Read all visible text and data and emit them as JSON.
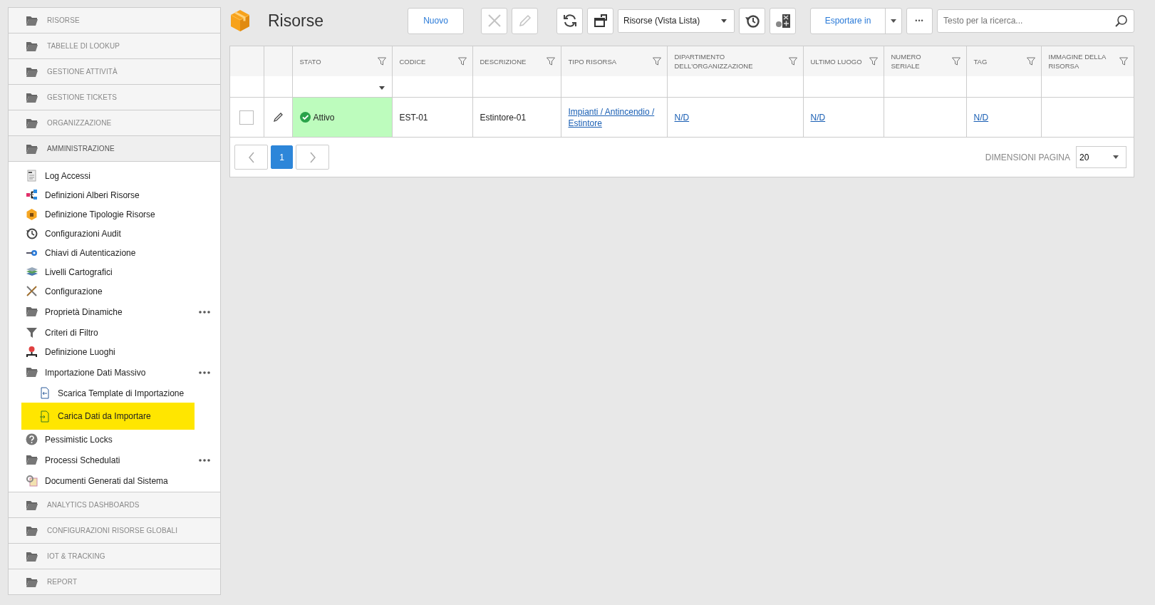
{
  "sidebar": {
    "sections": [
      {
        "label": "RISORSE",
        "expanded": false
      },
      {
        "label": "TABELLE DI LOOKUP",
        "expanded": false
      },
      {
        "label": "GESTIONE ATTIVITÀ",
        "expanded": false
      },
      {
        "label": "GESTIONE TICKETS",
        "expanded": false
      },
      {
        "label": "ORGANIZZAZIONE",
        "expanded": false
      },
      {
        "label": "AMMINISTRAZIONE",
        "expanded": true,
        "items": [
          {
            "label": "Log Accessi",
            "kind": "log",
            "has_menu": false,
            "highlighted": false
          },
          {
            "label": "Definizioni Alberi Risorse",
            "kind": "tree",
            "has_menu": false,
            "highlighted": false
          },
          {
            "label": "Definizione Tipologie Risorse",
            "kind": "types",
            "has_menu": false,
            "highlighted": false
          },
          {
            "label": "Configurazioni Audit",
            "kind": "audit",
            "has_menu": false,
            "highlighted": false
          },
          {
            "label": "Chiavi di Autenticazione",
            "kind": "key",
            "has_menu": false,
            "highlighted": false
          },
          {
            "label": "Livelli Cartografici",
            "kind": "layers",
            "has_menu": false,
            "highlighted": false
          },
          {
            "label": "Configurazione",
            "kind": "tools",
            "has_menu": false,
            "highlighted": false
          },
          {
            "label": "Proprietà Dinamiche",
            "kind": "folder",
            "has_menu": true,
            "highlighted": false
          },
          {
            "label": "Criteri di Filtro",
            "kind": "filter",
            "has_menu": false,
            "highlighted": false
          },
          {
            "label": "Definizione Luoghi",
            "kind": "places",
            "has_menu": false,
            "highlighted": false
          },
          {
            "label": "Importazione Dati Massivo",
            "kind": "folder",
            "has_menu": true,
            "highlighted": false,
            "children": [
              {
                "label": "Scarica Template di Importazione",
                "kind": "download",
                "has_menu": false,
                "highlighted": false
              },
              {
                "label": "Carica Dati da Importare",
                "kind": "upload",
                "has_menu": false,
                "highlighted": true
              }
            ]
          },
          {
            "label": "Pessimistic Locks",
            "kind": "help",
            "has_menu": false,
            "highlighted": false
          },
          {
            "label": "Processi Schedulati",
            "kind": "folder",
            "has_menu": true,
            "highlighted": false
          },
          {
            "label": "Documenti Generati dal Sistema",
            "kind": "docs",
            "has_menu": false,
            "highlighted": false
          }
        ]
      },
      {
        "label": "ANALYTICS DASHBOARDS",
        "expanded": false
      },
      {
        "label": "CONFIGURAZIONI RISORSE GLOBALI",
        "expanded": false
      },
      {
        "label": "IOT & TRACKING",
        "expanded": false
      },
      {
        "label": "REPORT",
        "expanded": false
      }
    ]
  },
  "header": {
    "title": "Risorse",
    "new_button": "Nuovo",
    "delete_disabled": true,
    "edit_disabled": true,
    "view_select": "Risorse (Vista Lista)",
    "export_button": "Esportare in",
    "more_button": "•••",
    "search": {
      "placeholder": "Testo per la ricerca..."
    }
  },
  "table": {
    "columns": [
      {
        "label": "STATO",
        "has_filter_select": true
      },
      {
        "label": "CODICE",
        "has_filter_select": false
      },
      {
        "label": "DESCRIZIONE",
        "has_filter_select": false
      },
      {
        "label": "TIPO RISORSA",
        "has_filter_select": false
      },
      {
        "label": "DIPARTIMENTO DELL'ORGANIZZAZIONE",
        "has_filter_select": false
      },
      {
        "label": "ULTIMO LUOGO",
        "has_filter_select": false
      },
      {
        "label": "NUMERO SERIALE",
        "has_filter_select": false
      },
      {
        "label": "TAG",
        "has_filter_select": false
      },
      {
        "label": "IMMAGINE DELLA RISORSA",
        "has_filter_select": false
      }
    ],
    "rows": [
      {
        "checked": false,
        "cells": [
          {
            "kind": "status",
            "text": "Attivo",
            "color": "#bdfcbd"
          },
          {
            "kind": "text",
            "text": "EST-01"
          },
          {
            "kind": "text",
            "text": "Estintore-01"
          },
          {
            "kind": "link",
            "text": "Impianti / Antincendio / Estintore"
          },
          {
            "kind": "link",
            "text": "N/D"
          },
          {
            "kind": "link",
            "text": "N/D"
          },
          {
            "kind": "text",
            "text": ""
          },
          {
            "kind": "link",
            "text": "N/D"
          },
          {
            "kind": "text",
            "text": ""
          }
        ]
      }
    ]
  },
  "pager": {
    "pages": [
      {
        "label": "1",
        "selected": true
      }
    ],
    "page_size_label": "DIMENSIONI PAGINA",
    "page_size": "20"
  }
}
